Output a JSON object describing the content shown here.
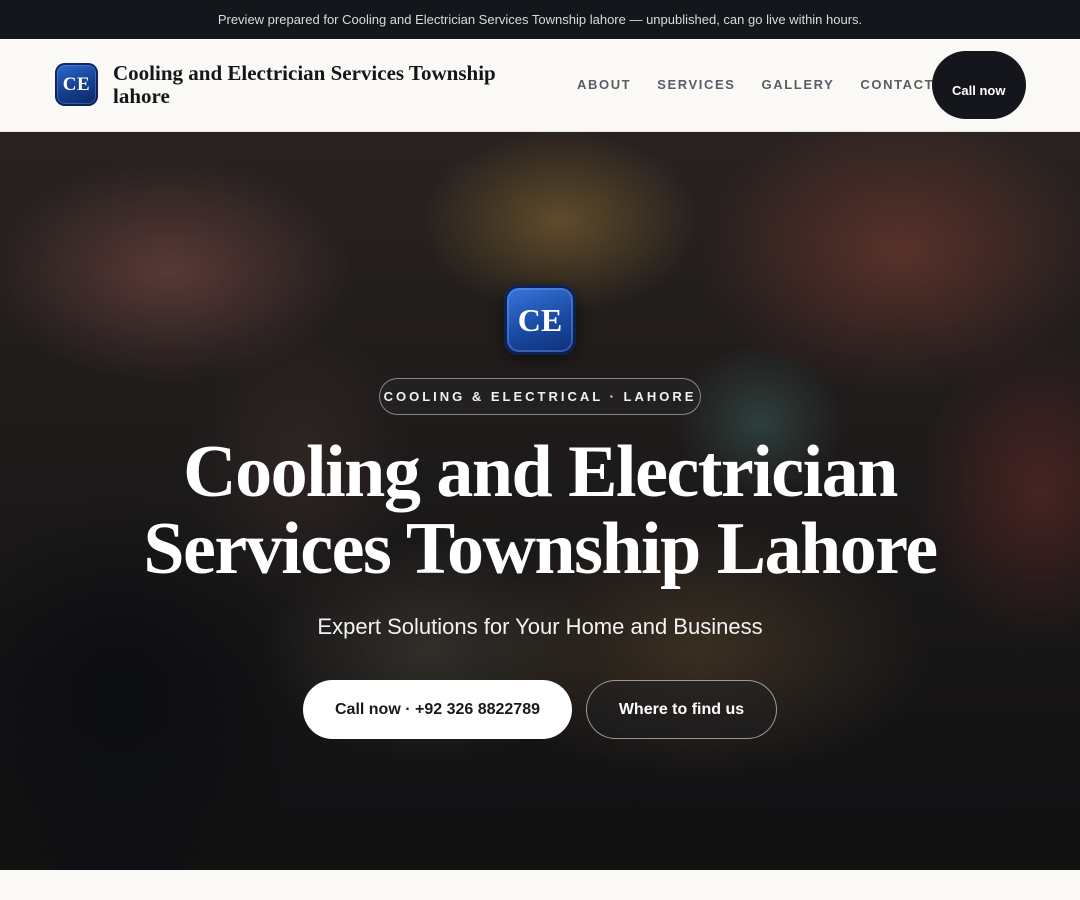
{
  "preview_banner": {
    "text": "Preview prepared for Cooling and Electrician Services Township lahore — unpublished, can go live within hours."
  },
  "header": {
    "logo_initials": "CE",
    "brand_name": "Cooling and Electrician Services Township lahore",
    "nav": [
      {
        "label": "ABOUT"
      },
      {
        "label": "SERVICES"
      },
      {
        "label": "GALLERY"
      },
      {
        "label": "CONTACT"
      }
    ],
    "call_label": "Call now"
  },
  "hero": {
    "badge_initials": "CE",
    "eyebrow": "COOLING & ELECTRICAL · LAHORE",
    "title": "Cooling and Electrician Services Township Lahore",
    "subtitle": "Expert Solutions for Your Home and Business",
    "primary_cta": "Call now · +92 326 8822789",
    "secondary_cta": "Where to find us"
  },
  "colors": {
    "topbar_bg": "#13161b",
    "header_bg": "#faf9f6",
    "logo_blue": "#1a4aa3",
    "call_button_bg": "#14161b"
  }
}
